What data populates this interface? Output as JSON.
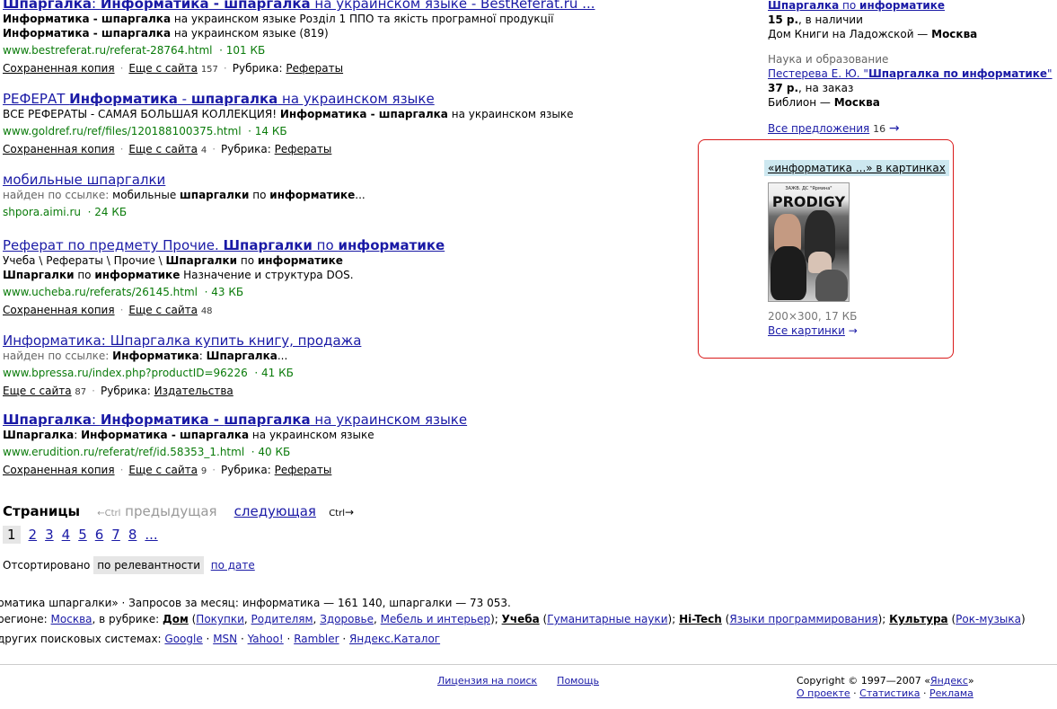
{
  "results": [
    {
      "title_a": "Шпаргалка",
      "title_b": ": ",
      "title_c": "Информатика",
      "title_d": " - ",
      "title_e": "шпаргалка",
      "title_f": " на украинском языке - BestReferat.ru ...",
      "snippet1_a": "Информатика - шпаргалка",
      "snippet1_b": " на украинском языке Розділ 1 ППО та якість програмної продукції",
      "snippet2_a": "Информатика - шпаргалка",
      "snippet2_b": " на украинском языке (819)",
      "url": "www.bestreferat.ru/referat-28764.html",
      "size": "· 101 КБ",
      "cached": "Сохраненная копия",
      "more": "Еще с сайта",
      "more_count": "157",
      "rubric_label": "Рубрика:",
      "rubric": "Рефераты"
    },
    {
      "title_a": "РЕФЕРАТ ",
      "title_b": "Информатика",
      "title_c": " - ",
      "title_d": "шпаргалка",
      "title_e": " на украинском языке",
      "snippet1_a": "ВСЕ РЕФЕРАТЫ - САМАЯ БОЛЬШАЯ КОЛЛЕКЦИЯ! ",
      "snippet1_b": "Информатика - шпаргалка",
      "snippet1_c": " на украинском языке",
      "url": "www.goldref.ru/ref/files/120188100375.html",
      "size": "· 14 КБ",
      "cached": "Сохраненная копия",
      "more": "Еще с сайта",
      "more_count": "4",
      "rubric_label": "Рубрика:",
      "rubric": "Рефераты"
    },
    {
      "title": "мобильные шпаргалки",
      "found_label": "найден по ссылке: ",
      "found_a": "мобильные ",
      "found_b": "шпаргалки",
      "found_c": " по ",
      "found_d": "информатике",
      "found_e": "...",
      "url": "shpora.aimi.ru",
      "size": "· 24 КБ"
    },
    {
      "title_a": "Реферат по предмету Прочие. ",
      "title_b": "Шпаргалки",
      "title_c": " по ",
      "title_d": "информатике",
      "snippet1_a": "Учеба \\ Рефераты \\ Прочие \\ ",
      "snippet1_b": "Шпаргалки",
      "snippet1_c": " по ",
      "snippet1_d": "информатике",
      "snippet2_a": "Шпаргалки",
      "snippet2_b": " по ",
      "snippet2_c": "информатике",
      "snippet2_d": " Назначение и структура DOS.",
      "url": "www.ucheba.ru/referats/26145.html",
      "size": "· 43 КБ",
      "cached": "Сохраненная копия",
      "more": "Еще с сайта",
      "more_count": "48"
    },
    {
      "title": "Информатика: Шпаргалка купить книгу, продажа",
      "found_label": "найден по ссылке: ",
      "found_a": "Информатика",
      "found_b": ": ",
      "found_c": "Шпаргалка",
      "found_d": "...",
      "url": "www.bpressa.ru/index.php?productID=96226",
      "size": "· 41 КБ",
      "more": "Еще с сайта",
      "more_count": "87",
      "rubric_label": "Рубрика:",
      "rubric": "Издательства"
    },
    {
      "title_a": "Шпаргалка",
      "title_b": ": ",
      "title_c": "Информатика",
      "title_d": " - ",
      "title_e": "шпаргалка",
      "title_f": " на украинском языке",
      "snippet1_a": "Шпаргалка",
      "snippet1_b": ": ",
      "snippet1_c": "Информатика - шпаргалка",
      "snippet1_d": " на украинском языке",
      "url": "www.erudition.ru/referat/ref/id.58353_1.html",
      "size": "· 40 КБ",
      "cached": "Сохраненная копия",
      "more": "Еще с сайта",
      "more_count": "9",
      "rubric_label": "Рубрика:",
      "rubric": "Рефераты"
    }
  ],
  "pager": {
    "label": "Страницы",
    "prev_arrow": "←",
    "ctrl": "Ctrl",
    "prev": "предыдущая",
    "next": "следующая",
    "next_arrow": "→",
    "current": "1",
    "pages": [
      "2",
      "3",
      "4",
      "5",
      "6",
      "7",
      "8",
      "..."
    ]
  },
  "sort": {
    "label": "Отсортировано",
    "active": "по релевантности",
    "other": "по дате"
  },
  "stats_line": "рматика шпаргалки» · Запросов за месяц: информатика — 161 140, шпаргалки — 73 053.",
  "region_line": {
    "prefix": "регионе: ",
    "city": "Москва",
    "mid": ", в рубрике: ",
    "dom": "Дом",
    "dom_items": [
      "Покупки",
      "Родителям",
      "Здоровье",
      "Мебель и интерьер"
    ],
    "ucheba": "Учеба",
    "ucheba_items": [
      "Гуманитарные науки"
    ],
    "hitech": "Hi-Tech",
    "hitech_items": [
      "Языки программирования"
    ],
    "kultura": "Культура",
    "kultura_items": [
      "Рок-музыка"
    ]
  },
  "engines_line": {
    "prefix": "других поисковых системах: ",
    "engines": [
      "Google",
      "MSN",
      "Yahoo!",
      "Rambler",
      "Яндекс.Каталог"
    ]
  },
  "footer": {
    "license": "Лицензия на поиск",
    "help": "Помощь",
    "copyright_prefix": "Copyright © 1997—2007 «",
    "yandex": "Яндекс",
    "copyright_suffix": "»",
    "about": "О проекте",
    "stats": "Статистика",
    "ads": "Реклама"
  },
  "right": {
    "offer1_title_a": "Шпаргалка",
    "offer1_title_b": " по ",
    "offer1_title_c": "информатике",
    "offer1_price": "15 р.",
    "offer1_avail": ", в наличии",
    "offer1_shop": "Дом Книги на Ладожской — ",
    "offer1_city": "Москва",
    "offer2_cat": "Наука и образование",
    "offer2_title_a": "Пестерева Е. Ю. \"",
    "offer2_title_b": "Шпаргалка по информатике",
    "offer2_title_c": "\"",
    "offer2_price": "37 р.",
    "offer2_avail": ", на заказ",
    "offer2_shop": "Библион — ",
    "offer2_city": "Москва",
    "all_offers": "Все предложения",
    "all_offers_count": "16",
    "arrow": "→"
  },
  "images": {
    "header": "«информатика ...» в картинках",
    "cover_small": "ЗАЖВ. ДС \"Ярмина\"",
    "cover_title": "PRODIGY",
    "dims": "200×300, 17 КБ",
    "all": "Все картинки",
    "arrow": "→",
    "border_color": "#d91a1a"
  }
}
